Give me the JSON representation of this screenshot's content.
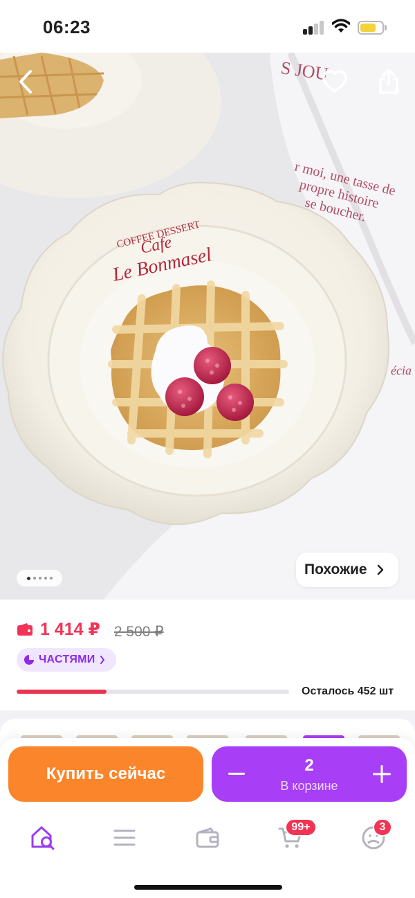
{
  "status_bar": {
    "time": "06:23",
    "battery_color": "#f2d33b"
  },
  "product_gallery": {
    "icons": [
      "back-icon",
      "heart-icon",
      "share-icon"
    ],
    "page_count": 5,
    "active_page": 0,
    "similar_label": "Похожие"
  },
  "price": {
    "current": "1 414 ₽",
    "old": "2 500 ₽",
    "accent_color": "#f23355",
    "installments_label": "ЧАСТЯМИ"
  },
  "stock": {
    "text": "Осталось 452 шт",
    "progress_percent": 33
  },
  "actions": {
    "buy_now_label": "Купить сейчас",
    "cart_quantity": "2",
    "cart_caption": "В корзине",
    "buy_color": "#fb852b",
    "cart_color": "#a83ef5"
  },
  "bottom_nav": {
    "items": [
      {
        "icon": "home-search-icon",
        "active": true
      },
      {
        "icon": "catalog-icon"
      },
      {
        "icon": "wallet-icon"
      },
      {
        "icon": "cart-icon",
        "badge": "99+"
      },
      {
        "icon": "profile-icon",
        "badge": "3"
      }
    ],
    "active_color": "#9b3cf0"
  }
}
